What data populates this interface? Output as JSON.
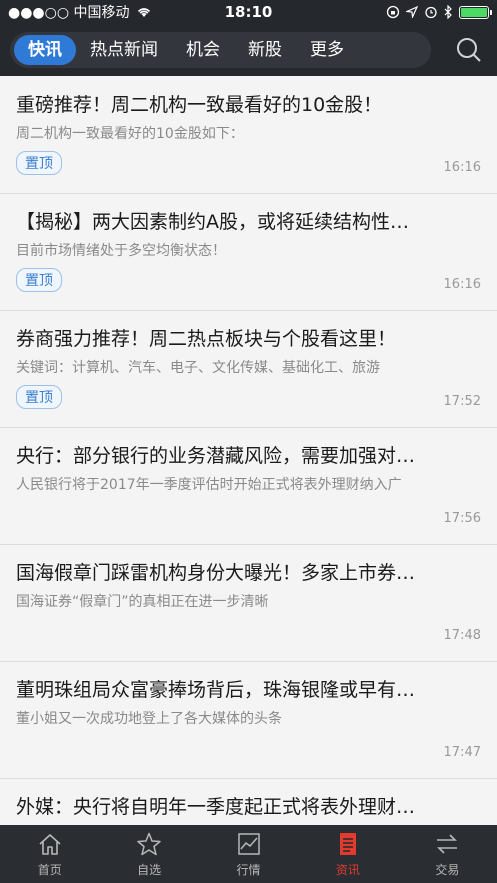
{
  "status": {
    "carrier": "●●●○○ 中国移动",
    "time": "18:10"
  },
  "nav": {
    "tabs": [
      {
        "label": "快讯",
        "active": true
      },
      {
        "label": "热点新闻",
        "active": false
      },
      {
        "label": "机会",
        "active": false
      },
      {
        "label": "新股",
        "active": false
      },
      {
        "label": "更多",
        "active": false
      }
    ]
  },
  "feed": [
    {
      "title": "重磅推荐！周二机构一致最看好的10金股！",
      "sub": "周二机构一致最看好的10金股如下：",
      "badge": "置顶",
      "time": "16:16"
    },
    {
      "title": "【揭秘】两大因素制约A股，或将延续结构性…",
      "sub": "目前市场情绪处于多空均衡状态！",
      "badge": "置顶",
      "time": "16:16"
    },
    {
      "title": "券商强力推荐！周二热点板块与个股看这里！",
      "sub": "关键词：计算机、汽车、电子、文化传媒、基础化工、旅游",
      "badge": "置顶",
      "time": "17:52"
    },
    {
      "title": "央行：部分银行的业务潜藏风险，需要加强对…",
      "sub": "人民银行将于2017年一季度评估时开始正式将表外理财纳入广",
      "badge": "",
      "time": "17:56"
    },
    {
      "title": "国海假章门踩雷机构身份大曝光！多家上市券…",
      "sub": "国海证券“假章门”的真相正在进一步清晰",
      "badge": "",
      "time": "17:48"
    },
    {
      "title": "董明珠组局众富豪捧场背后，珠海银隆或早有…",
      "sub": "董小姐又一次成功地登上了各大媒体的头条",
      "badge": "",
      "time": "17:47"
    },
    {
      "title": "外媒：央行将自明年一季度起正式将表外理财…",
      "sub": "",
      "badge": "",
      "time": ""
    }
  ],
  "tabbar": [
    {
      "label": "首页",
      "icon": "home-icon",
      "active": false
    },
    {
      "label": "自选",
      "icon": "star-icon",
      "active": false
    },
    {
      "label": "行情",
      "icon": "chart-icon",
      "active": false
    },
    {
      "label": "资讯",
      "icon": "news-icon",
      "active": true
    },
    {
      "label": "交易",
      "icon": "trade-icon",
      "active": false
    }
  ],
  "colors": {
    "accent": "#2f7ad6",
    "tabbar_active": "#e33a2f",
    "header_bg": "#25282d"
  }
}
